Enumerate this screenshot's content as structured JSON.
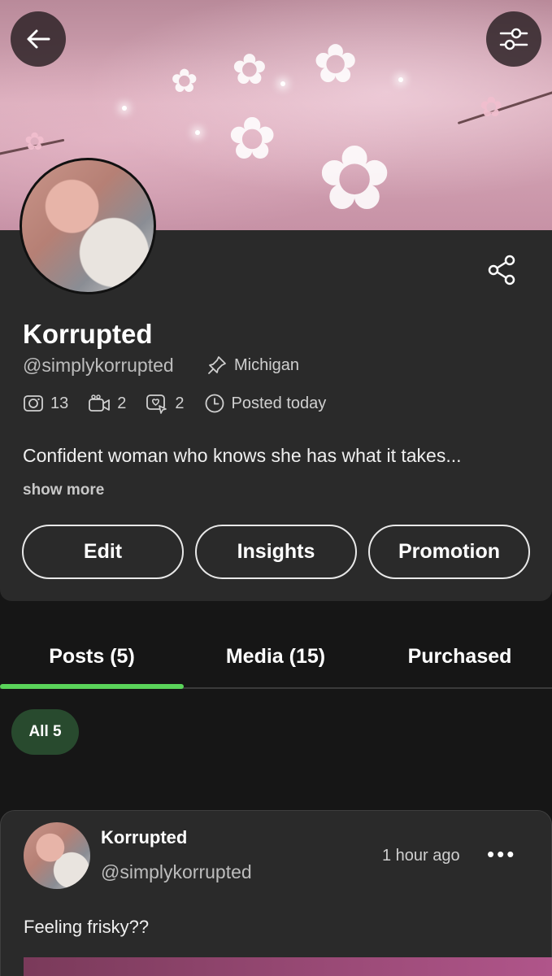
{
  "header": {
    "back_icon": "arrow-left-icon",
    "settings_icon": "sliders-icon"
  },
  "profile": {
    "name": "Korrupted",
    "handle": "@simplykorrupted",
    "location": "Michigan",
    "stats": {
      "photos": "13",
      "videos": "2",
      "streams": "2",
      "last_post": "Posted today"
    },
    "bio": "Confident woman who knows she has what it takes...",
    "show_more": "show more",
    "share_icon": "share-icon"
  },
  "actions": {
    "edit": "Edit",
    "insights": "Insights",
    "promotion": "Promotion"
  },
  "tabs": [
    {
      "label": "Posts (5)",
      "active": true
    },
    {
      "label": "Media (15)",
      "active": false
    },
    {
      "label": "Purchased",
      "active": false
    }
  ],
  "filter": {
    "chip_label": "All 5"
  },
  "post": {
    "author": "Korrupted",
    "handle": "@simplykorrupted",
    "time": "1 hour ago",
    "text": "Feeling frisky??",
    "more_icon": "more-dots-icon"
  },
  "colors": {
    "background": "#161616",
    "card": "#2a2a2a",
    "accent_green": "#5ad45a",
    "chip_bg": "#284a2e"
  }
}
